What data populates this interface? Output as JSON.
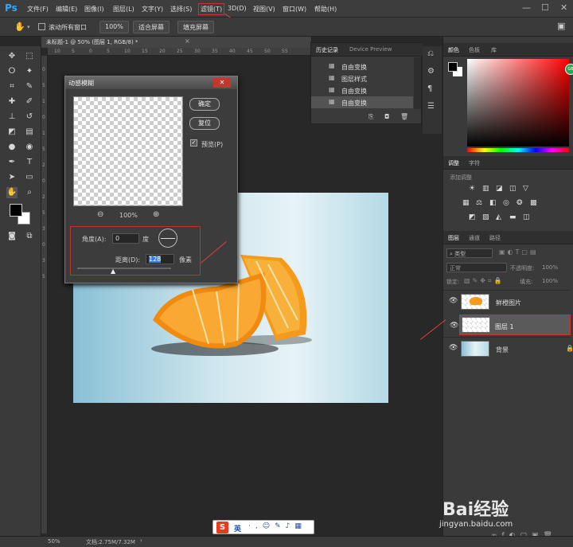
{
  "app": {
    "logo": "Ps"
  },
  "menubar": {
    "items": [
      "文件(F)",
      "编辑(E)",
      "图像(I)",
      "图层(L)",
      "文字(Y)",
      "选择(S)",
      "滤镜(T)",
      "3D(D)",
      "视图(V)",
      "窗口(W)",
      "帮助(H)"
    ],
    "window_controls": [
      "—",
      "☐",
      "✕"
    ]
  },
  "options_bar": {
    "checkbox_label": "滚动所有窗口",
    "zoom_value": "100%",
    "fit_screen": "适合屏幕",
    "fill_screen": "填充屏幕"
  },
  "document": {
    "tab_title": "未标题-1 @ 50% (图层 1, RGB/8) *",
    "ruler_top_ticks": [
      "10",
      "5",
      "0",
      "5",
      "10",
      "15",
      "20",
      "25",
      "30",
      "35",
      "40",
      "45",
      "50",
      "55"
    ],
    "ruler_left_ticks": [
      "0",
      "5",
      "1",
      "0",
      "1",
      "5",
      "2",
      "0",
      "2",
      "5",
      "3",
      "0",
      "3",
      "5"
    ]
  },
  "history_panel": {
    "tabs": [
      "历史记录",
      "Device Preview"
    ],
    "items": [
      "自由变换",
      "图层样式",
      "自由变换",
      "自由变换"
    ]
  },
  "dialog": {
    "title": "动感模糊",
    "ok": "确定",
    "reset": "复位",
    "preview_label": "预览(P)",
    "preview_checked": true,
    "zoom_percent": "100%",
    "angle_label": "角度(A):",
    "angle_value": "0",
    "angle_unit": "度",
    "distance_label": "距离(D):",
    "distance_value": "128",
    "distance_unit": "像素"
  },
  "color_panel": {
    "tabs": [
      "颜色",
      "色板",
      "库"
    ]
  },
  "adjustments_panel": {
    "tabs": [
      "调整",
      "字符"
    ],
    "add_label": "添加调整"
  },
  "layers_panel": {
    "tabs": [
      "图层",
      "通道",
      "路径"
    ],
    "filter_kind": "类型",
    "blend_mode": "正常",
    "opacity_label": "不透明度:",
    "opacity_value": "100%",
    "lock_label": "锁定:",
    "fill_label": "填充:",
    "fill_value": "100%",
    "layers": [
      {
        "name": "鲜橙图片",
        "selected": false
      },
      {
        "name": "图层 1",
        "selected": true
      },
      {
        "name": "背景",
        "selected": false
      }
    ]
  },
  "status_bar": {
    "zoom": "50%",
    "doc_info": "文档:2.75M/7.32M"
  },
  "ime_bar": {
    "logo": "S",
    "mode": "英"
  },
  "watermark": {
    "brand": "Bai经验",
    "url": "jingyan.baidu.com"
  },
  "colors": {
    "accent_red": "#d03030",
    "ps_blue": "#31a8ff",
    "orange": "#f59a1a"
  }
}
